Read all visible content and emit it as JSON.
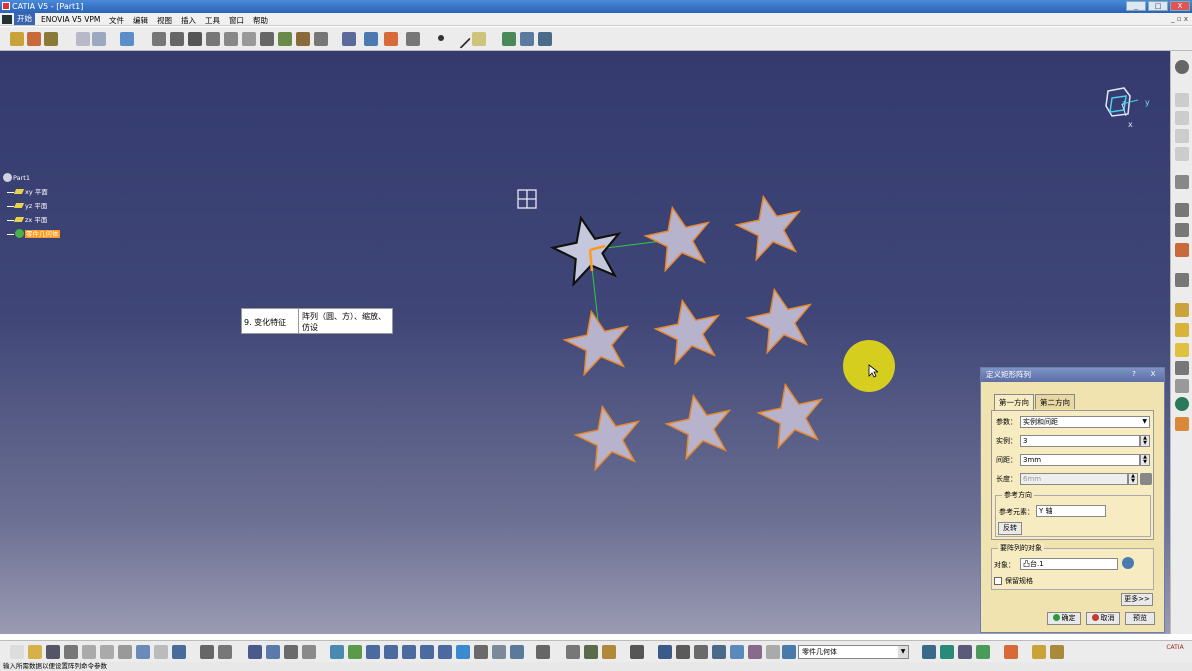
{
  "window": {
    "title": "CATIA V5 - [Part1]",
    "buttons": [
      "_",
      "□",
      "X"
    ]
  },
  "menu": {
    "items": [
      "开始",
      "ENOVIA V5 VPM",
      "文件",
      "编辑",
      "视图",
      "插入",
      "工具",
      "窗口",
      "帮助"
    ],
    "right_buttons": "_ ▫ x"
  },
  "tree": {
    "root": "Part1",
    "children": [
      "xy 平面",
      "yz 平面",
      "zx 平面"
    ],
    "body": "零件几何体"
  },
  "annotation": {
    "left": "9. 变化特征",
    "right": "阵列（圆、方）、缩放、仿设"
  },
  "compass": {
    "x_label": "x",
    "y_label": "y",
    "z_label": "z"
  },
  "dialog": {
    "title": "定义矩形阵列",
    "help_btn": "?",
    "close_btn": "X",
    "tabs": [
      "第一方向",
      "第二方向"
    ],
    "param_label": "参数：",
    "param_value": "实例和间距",
    "instances_label": "实例：",
    "instances_value": "3",
    "spacing_label": "间距：",
    "spacing_value": "3mm",
    "length_label": "长度：",
    "length_value": "6mm",
    "ref_dir_group": "参考方向",
    "ref_elem_label": "参考元素：",
    "ref_elem_value": "Y 轴",
    "reverse_btn": "反转",
    "object_group": "要阵列的对象",
    "object_label": "对象：",
    "object_value": "凸台.1",
    "keep_spec_label": "保留规格",
    "more_btn": "更多>>",
    "ok_btn": "确定",
    "cancel_btn": "取消",
    "preview_btn": "预览"
  },
  "bottom_toolbar": {
    "body_select": "零件几何体"
  },
  "status": {
    "text": "输入所需数据以便设置阵列命令参数"
  },
  "colors": {
    "accent": "#ff9a1e",
    "viewport_top": "#343a6e",
    "dialog_bg": "#f1e3b0"
  }
}
